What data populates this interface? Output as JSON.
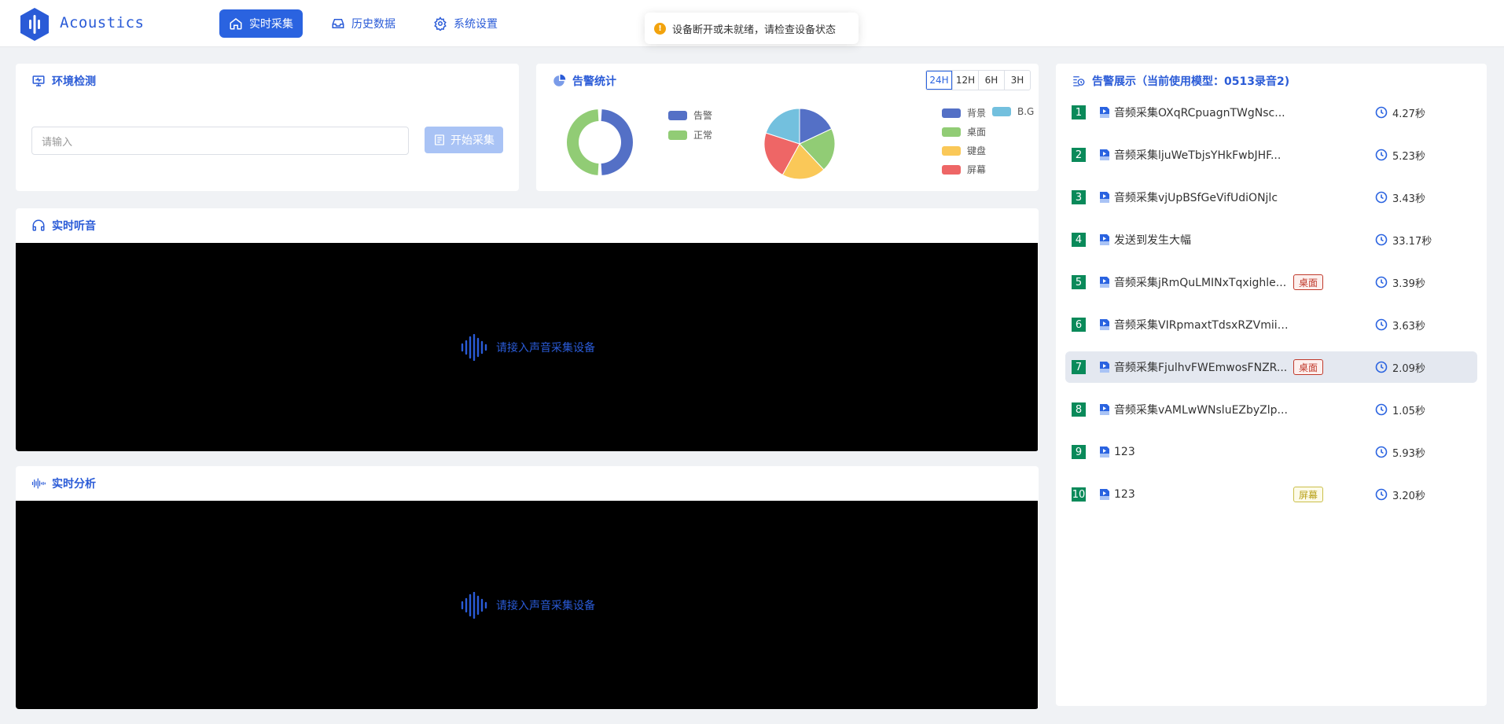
{
  "header": {
    "brand": "Acoustics",
    "nav": [
      {
        "label": "实时采集",
        "icon": "home-icon",
        "active": true
      },
      {
        "label": "历史数据",
        "icon": "inbox-icon",
        "active": false
      },
      {
        "label": "系统设置",
        "icon": "gear-icon",
        "active": false
      }
    ]
  },
  "toast": {
    "message": "设备断开或未就绪，请检查设备状态",
    "icon": "warning-icon",
    "icon_glyph": "!"
  },
  "env": {
    "title": "环境检测",
    "input_placeholder": "请输入",
    "start_label": "开始采集"
  },
  "stats": {
    "title": "告警统计",
    "ranges": [
      "24H",
      "12H",
      "6H",
      "3H"
    ],
    "active_range": "24H",
    "donut_legend": [
      {
        "label": "告警",
        "color": "#5470c6"
      },
      {
        "label": "正常",
        "color": "#91cc75"
      }
    ],
    "pie_legend": [
      {
        "label": "背景",
        "color": "#5470c6"
      },
      {
        "label": "B.G",
        "color": "#73c0de"
      },
      {
        "label": "桌面",
        "color": "#91cc75"
      },
      {
        "label": "键盘",
        "color": "#fac858"
      },
      {
        "label": "屏幕",
        "color": "#ee6666"
      }
    ]
  },
  "chart_data": [
    {
      "type": "pie",
      "variant": "donut",
      "categories": [
        "告警",
        "正常"
      ],
      "values": [
        50,
        50
      ]
    },
    {
      "type": "pie",
      "categories": [
        "背景",
        "桌面",
        "键盘",
        "屏幕",
        "B.G"
      ],
      "values": [
        18,
        20,
        20,
        22,
        20
      ]
    }
  ],
  "listen": {
    "title": "实时听音",
    "placeholder": "请接入声音采集设备"
  },
  "analysis": {
    "title": "实时分析",
    "placeholder": "请接入声音采集设备"
  },
  "alerts": {
    "title": "告警展示（当前使用模型：0513录音2)",
    "items": [
      {
        "no": "1",
        "name": "音频采集OXqRCpuagnTWgNsc...",
        "tag": "",
        "duration": "4.27秒"
      },
      {
        "no": "2",
        "name": "音频采集ljuWeTbjsYHkFwbJHF...",
        "tag": "",
        "duration": "5.23秒"
      },
      {
        "no": "3",
        "name": "音频采集vjUpBSfGeVifUdiONjlc",
        "tag": "",
        "duration": "3.43秒"
      },
      {
        "no": "4",
        "name": "发送到发生大幅",
        "tag": "",
        "duration": "33.17秒"
      },
      {
        "no": "5",
        "name": "音频采集jRmQuLMINxTqxighle...",
        "tag": "桌面",
        "tag_color": "red",
        "duration": "3.39秒"
      },
      {
        "no": "6",
        "name": "音频采集VIRpmaxtTdsxRZVmiiVn",
        "tag": "",
        "duration": "3.63秒"
      },
      {
        "no": "7",
        "name": "音频采集FjulhvFWEmwosFNZR...",
        "tag": "桌面",
        "tag_color": "red",
        "duration": "2.09秒",
        "highlighted": true
      },
      {
        "no": "8",
        "name": "音频采集vAMLwWNsluEZbyZlp...",
        "tag": "",
        "duration": "1.05秒"
      },
      {
        "no": "9",
        "name": "123",
        "tag": "",
        "duration": "5.93秒"
      },
      {
        "no": "10",
        "name": "123",
        "tag": "屏幕",
        "tag_color": "yellow",
        "duration": "3.20秒"
      }
    ]
  }
}
